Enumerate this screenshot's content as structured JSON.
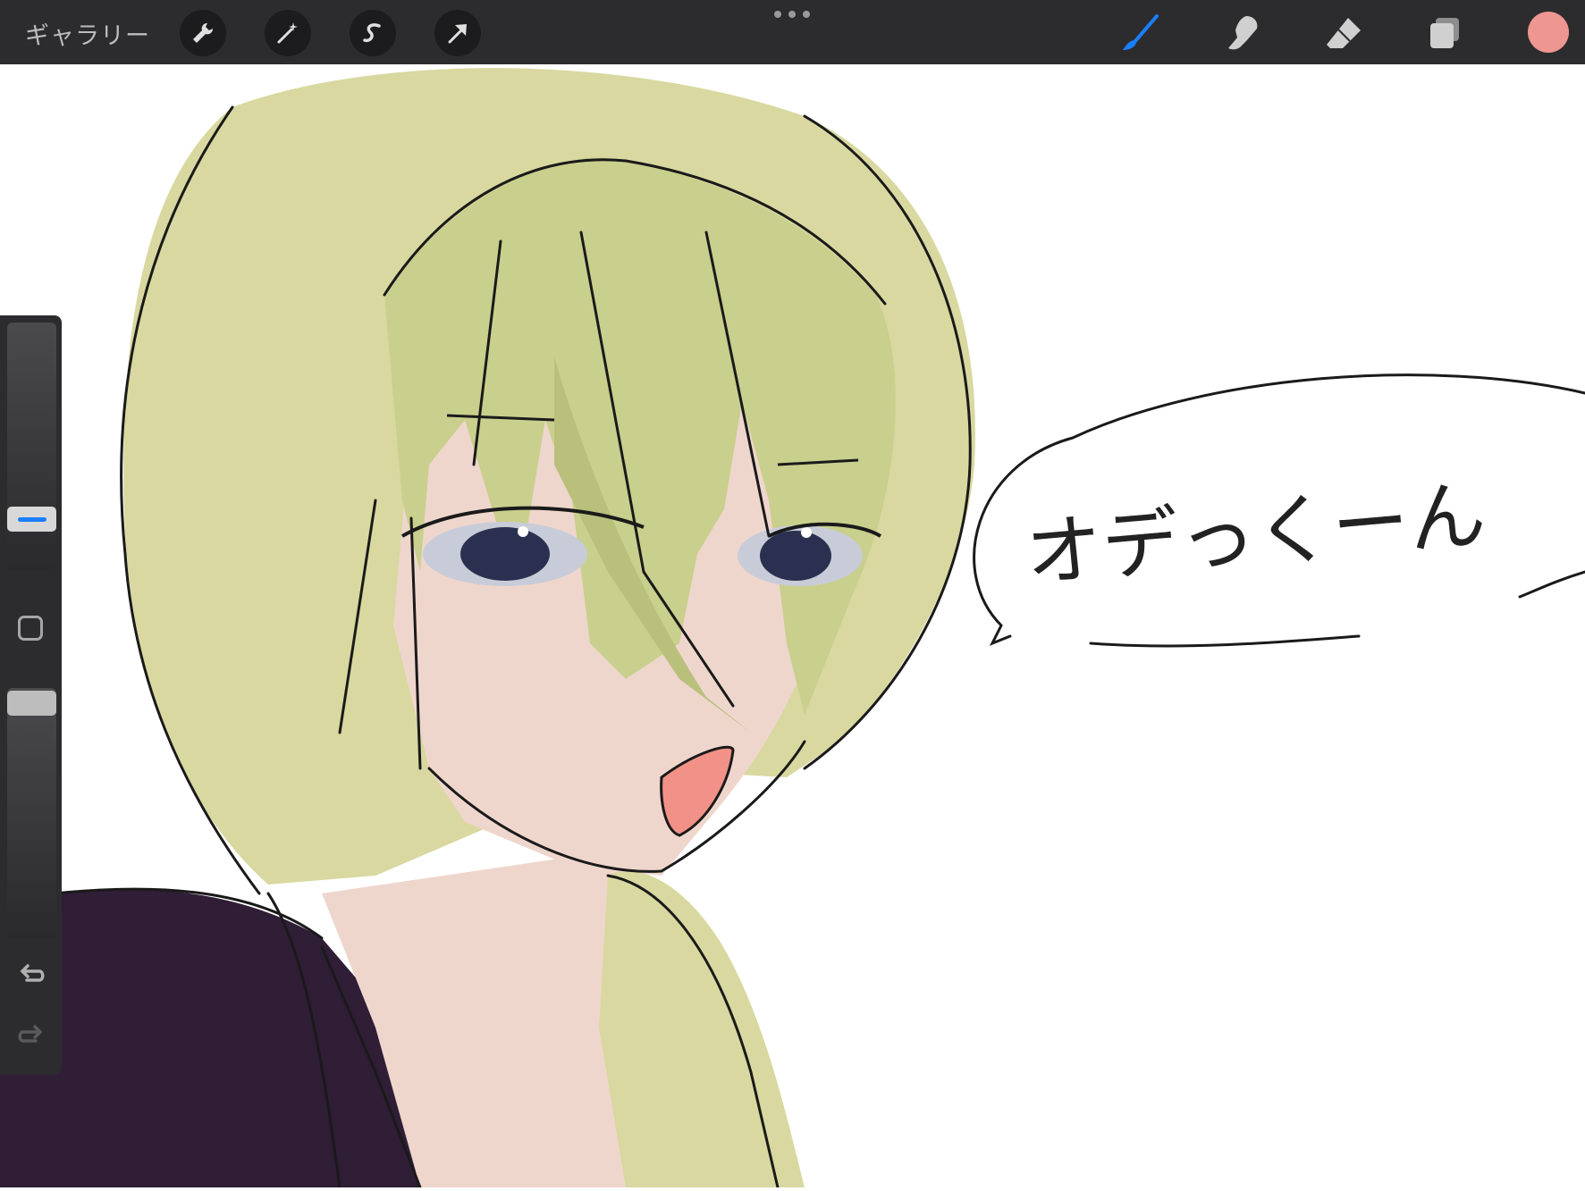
{
  "app": {
    "gallery_label": "ギャラリー"
  },
  "toolbar": {
    "left_tools": [
      {
        "name": "actions",
        "icon": "wrench-icon"
      },
      {
        "name": "adjustments",
        "icon": "magic-wand-icon"
      },
      {
        "name": "selection",
        "icon": "selection-s-icon"
      },
      {
        "name": "transform",
        "icon": "arrow-cursor-icon"
      }
    ],
    "more_icon": "more-dots-icon",
    "right_tools": [
      {
        "name": "brush",
        "icon": "brush-icon",
        "active": true
      },
      {
        "name": "smudge",
        "icon": "smudge-finger-icon",
        "active": false
      },
      {
        "name": "eraser",
        "icon": "eraser-icon",
        "active": false
      },
      {
        "name": "layers",
        "icon": "layers-icon",
        "active": false
      }
    ],
    "current_color": "#ee9690",
    "active_color": "#1a7fff"
  },
  "sidebar": {
    "brush_size_level": 0.78,
    "opacity_level": 0.97,
    "modify_icon": "square-modify-icon",
    "undo_icon": "undo-arrow-icon",
    "redo_icon": "redo-arrow-icon"
  },
  "artwork": {
    "speech_text": "オデっくーん",
    "hair_color": "#d8d8a0",
    "skin_color": "#efd6cd",
    "clothing_color": "#2f1e36"
  }
}
